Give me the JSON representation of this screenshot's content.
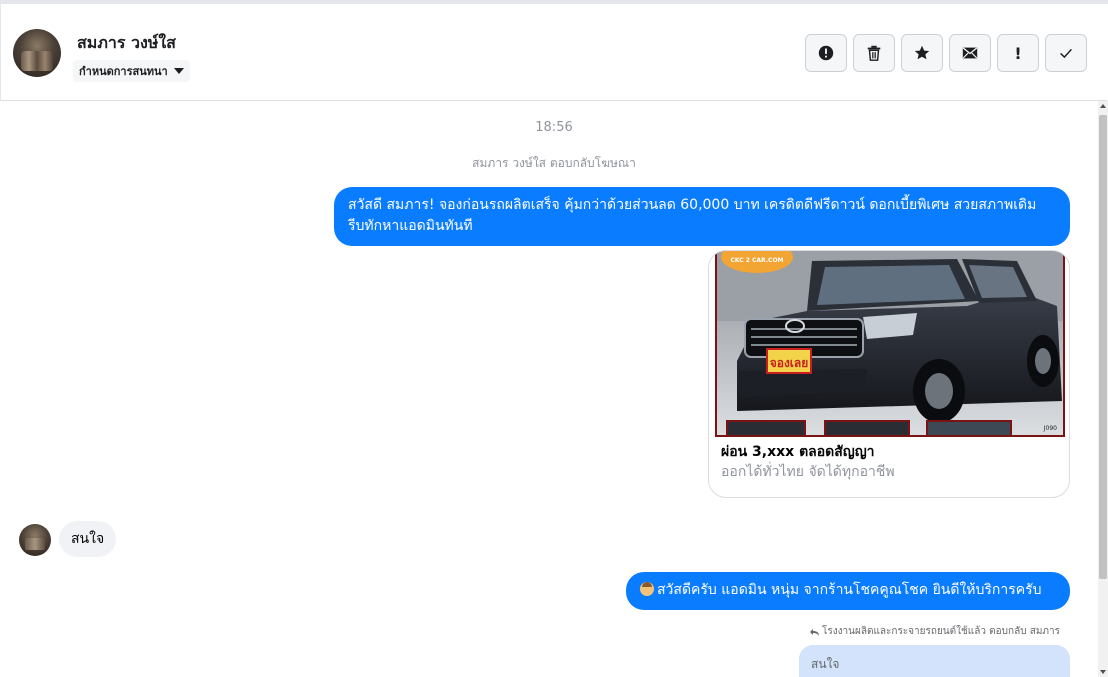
{
  "header": {
    "contact_name": "สมภาร วงษ์ใส",
    "conversation_menu_label": "กำหนดการสนทนา",
    "toolbar": [
      {
        "name": "report-button",
        "icon": "alert-circle-icon"
      },
      {
        "name": "delete-button",
        "icon": "trash-icon"
      },
      {
        "name": "star-button",
        "icon": "star-icon"
      },
      {
        "name": "mark-unread-button",
        "icon": "envelope-icon"
      },
      {
        "name": "important-button",
        "icon": "exclamation-icon",
        "label": "!"
      },
      {
        "name": "done-button",
        "icon": "check-icon"
      }
    ]
  },
  "chat": {
    "timestamp": "18:56",
    "ad_reply_note": "สมภาร วงษ์ใส ตอบกลับโฆษณา",
    "messages": {
      "ad_message": "สวัสดี สมภาร! จองก่อนรถผลิตเสร็จ คุ้มกว่าด้วยส่วนลด 60,000 บาท เครดิตดีฟรีดาวน์ ดอกเบี้ยพิเศษ สวยสภาพเดิม รีบทักหาแอดมินทันที",
      "ad_card": {
        "image_badge": "CKC 2 CAR.COM",
        "image_sticker": "จองเลย",
        "image_code": "J090",
        "title": "ผ่อน 3,xxx ตลอดสัญญา",
        "subtitle": "ออกได้ทั่วไทย จัดได้ทุกอาชีพ"
      },
      "incoming_reply": "สนใจ",
      "admin_greeting": "สวัสดีครับ แอดมิน หนุ่ม จากร้านโชคคูณโชค ยินดีให้บริการครับ",
      "reply_meta": "โรงงานผลิตและกระจายรถยนต์ใช้แล้ว ตอบกลับ สมภาร",
      "quoted_text": "สนใจ"
    }
  },
  "colors": {
    "outgoing_bubble": "#0a7cff",
    "incoming_bubble": "#f0f2f5",
    "quoted_bubble": "#d3e3fb",
    "meta_text": "#90949c"
  }
}
